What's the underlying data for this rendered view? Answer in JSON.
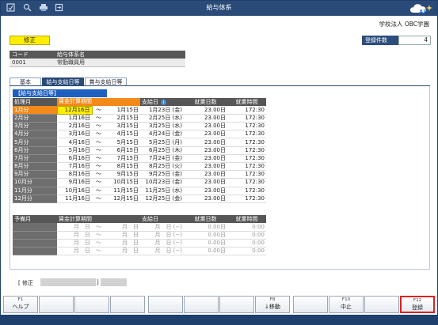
{
  "window": {
    "title": "給与体系"
  },
  "toolbar_icons": [
    "home-icon",
    "search-icon",
    "print-icon",
    "export-icon"
  ],
  "org_name": "学校法人 OBC学園",
  "mode_label": "修正",
  "record_count": {
    "label": "登録件数",
    "value": "4"
  },
  "header": {
    "code_label": "コード",
    "name_label": "給与体系名",
    "code_value": "0001",
    "name_value": "常勤職員用"
  },
  "tabs": [
    {
      "label": "基本"
    },
    {
      "label": "給与支給日等"
    },
    {
      "label": "賞与支給日等"
    }
  ],
  "section_title": "【給与支給日等】",
  "columns": {
    "month": "処理月",
    "period": "賃金計算期間",
    "payday": "支給日",
    "workdays": "就業日数",
    "workhours": "就業時間"
  },
  "rows": [
    {
      "month": "1月分",
      "start": "12月16日",
      "tilde": "〜",
      "end": "1月15日",
      "payday": "1月23日 (金)",
      "days": "23.00日",
      "hours": "172:30"
    },
    {
      "month": "2月分",
      "start": "1月16日",
      "tilde": "〜",
      "end": "2月15日",
      "payday": "2月25日 (水)",
      "days": "23.00日",
      "hours": "172:30"
    },
    {
      "month": "3月分",
      "start": "2月16日",
      "tilde": "〜",
      "end": "3月15日",
      "payday": "3月25日 (水)",
      "days": "23.00日",
      "hours": "172:30"
    },
    {
      "month": "4月分",
      "start": "3月16日",
      "tilde": "〜",
      "end": "4月15日",
      "payday": "4月24日 (金)",
      "days": "23.00日",
      "hours": "172:30"
    },
    {
      "month": "5月分",
      "start": "4月16日",
      "tilde": "〜",
      "end": "5月15日",
      "payday": "5月25日 (月)",
      "days": "23.00日",
      "hours": "172:30"
    },
    {
      "month": "6月分",
      "start": "5月16日",
      "tilde": "〜",
      "end": "6月15日",
      "payday": "6月25日 (木)",
      "days": "23.00日",
      "hours": "172:30"
    },
    {
      "month": "7月分",
      "start": "6月16日",
      "tilde": "〜",
      "end": "7月15日",
      "payday": "7月24日 (金)",
      "days": "23.00日",
      "hours": "172:30"
    },
    {
      "month": "8月分",
      "start": "7月16日",
      "tilde": "〜",
      "end": "8月15日",
      "payday": "8月25日 (火)",
      "days": "23.00日",
      "hours": "172:30"
    },
    {
      "month": "9月分",
      "start": "8月16日",
      "tilde": "〜",
      "end": "9月15日",
      "payday": "9月25日 (金)",
      "days": "23.00日",
      "hours": "172:30"
    },
    {
      "month": "10月分",
      "start": "9月16日",
      "tilde": "〜",
      "end": "10月15日",
      "payday": "10月23日 (金)",
      "days": "23.00日",
      "hours": "172:30"
    },
    {
      "month": "11月分",
      "start": "10月16日",
      "tilde": "〜",
      "end": "11月15日",
      "payday": "11月25日 (水)",
      "days": "23.00日",
      "hours": "172:30"
    },
    {
      "month": "12月分",
      "start": "11月16日",
      "tilde": "〜",
      "end": "12月15日",
      "payday": "12月25日 (金)",
      "days": "23.00日",
      "hours": "172:30"
    }
  ],
  "spare": {
    "columns": {
      "month": "予備月",
      "period": "賃金計算期間",
      "payday": "支給日",
      "workdays": "就業日数",
      "workhours": "就業時間"
    },
    "rows": [
      {
        "start": "月　日",
        "tilde": "〜",
        "end": "月　日",
        "payday": "月　日 (−)",
        "days": "0.00日",
        "hours": "0:00"
      },
      {
        "start": "月　日",
        "tilde": "〜",
        "end": "月　日",
        "payday": "月　日 (−)",
        "days": "0.00日",
        "hours": "0:00"
      },
      {
        "start": "月　日",
        "tilde": "〜",
        "end": "月　日",
        "payday": "月　日 (−)",
        "days": "0.00日",
        "hours": "0:00"
      },
      {
        "start": "月　日",
        "tilde": "〜",
        "end": "月　日",
        "payday": "月　日 (−)",
        "days": "0.00日",
        "hours": "0:00"
      }
    ]
  },
  "status": {
    "label_open": "[ 修正",
    "label_close": "]"
  },
  "fkeys": [
    {
      "key": "F1",
      "label": "ヘルプ"
    },
    {
      "key": "",
      "label": ""
    },
    {
      "key": "",
      "label": ""
    },
    {
      "key": "",
      "label": ""
    },
    {
      "key": "",
      "label": ""
    },
    {
      "key": "",
      "label": ""
    },
    {
      "key": "",
      "label": ""
    },
    {
      "key": "F8",
      "label": "↓移動"
    },
    {
      "key": "",
      "label": ""
    },
    {
      "key": "F10",
      "label": "中止"
    },
    {
      "key": "",
      "label": ""
    },
    {
      "key": "F12",
      "label": "登録"
    }
  ],
  "colors": {
    "titlebar": "#2a4a78",
    "accent_orange": "#f28a1a",
    "highlight_yellow": "#ffee00",
    "fkey_highlight": "#e0201e"
  }
}
